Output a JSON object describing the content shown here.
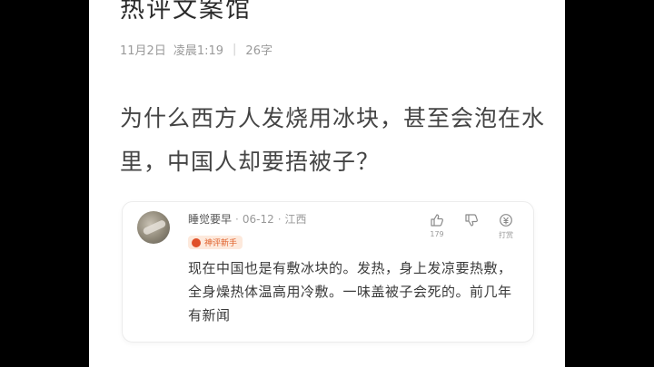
{
  "article": {
    "title": "热评文案馆",
    "date": "11月2日",
    "time": "凌晨1:19",
    "word_count": "26字",
    "question": "为什么西方人发烧用冰块，甚至会泡在水里，中国人却要捂被子？"
  },
  "comment": {
    "username": "睡觉要早",
    "date": "06-12",
    "location": "江西",
    "badge": "神评新手",
    "like_count": "179",
    "reward_label": "打赏",
    "text": "现在中国也是有敷冰块的。发热，身上发凉要热敷，全身燥热体温高用冷敷。一味盖被子会死的。前几年有新闻"
  },
  "icons": {
    "like": "thumbs-up-icon",
    "dislike": "thumbs-down-icon",
    "reward": "reward-icon"
  },
  "colors": {
    "badge_bg": "#fde9dc",
    "badge_text": "#e0602a"
  }
}
